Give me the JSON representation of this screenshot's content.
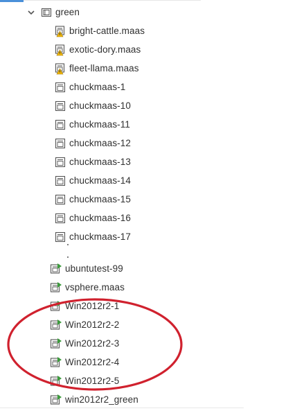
{
  "folder": {
    "name": "green",
    "expanded": true
  },
  "rows": [
    {
      "label": "bright-cattle.maas",
      "icon": "vm-warning-icon"
    },
    {
      "label": "exotic-dory.maas",
      "icon": "vm-warning-icon"
    },
    {
      "label": "fleet-llama.maas",
      "icon": "vm-warning-icon"
    },
    {
      "label": "chuckmaas-1",
      "icon": "vm-icon"
    },
    {
      "label": "chuckmaas-10",
      "icon": "vm-icon"
    },
    {
      "label": "chuckmaas-11",
      "icon": "vm-icon"
    },
    {
      "label": "chuckmaas-12",
      "icon": "vm-icon"
    },
    {
      "label": "chuckmaas-13",
      "icon": "vm-icon"
    },
    {
      "label": "chuckmaas-14",
      "icon": "vm-icon"
    },
    {
      "label": "chuckmaas-15",
      "icon": "vm-icon"
    },
    {
      "label": "chuckmaas-16",
      "icon": "vm-icon"
    },
    {
      "label": "chuckmaas-17",
      "icon": "vm-icon"
    },
    {
      "label": "ubuntutest-99",
      "icon": "vm-running-icon"
    },
    {
      "label": "vsphere.maas",
      "icon": "vm-running-icon"
    },
    {
      "label": "Win2012r2-1",
      "icon": "vm-running-icon"
    },
    {
      "label": "Win2012r2-2",
      "icon": "vm-running-icon"
    },
    {
      "label": "Win2012r2-3",
      "icon": "vm-running-icon"
    },
    {
      "label": "Win2012r2-4",
      "icon": "vm-running-icon"
    },
    {
      "label": "Win2012r2-5",
      "icon": "vm-running-icon"
    },
    {
      "label": "win2012r2_green",
      "icon": "vm-running-icon"
    }
  ],
  "colors": {
    "warning": "#f2b705",
    "running": "#3c9a3c",
    "annotation": "#d0212e",
    "accent": "#4a90d9"
  }
}
